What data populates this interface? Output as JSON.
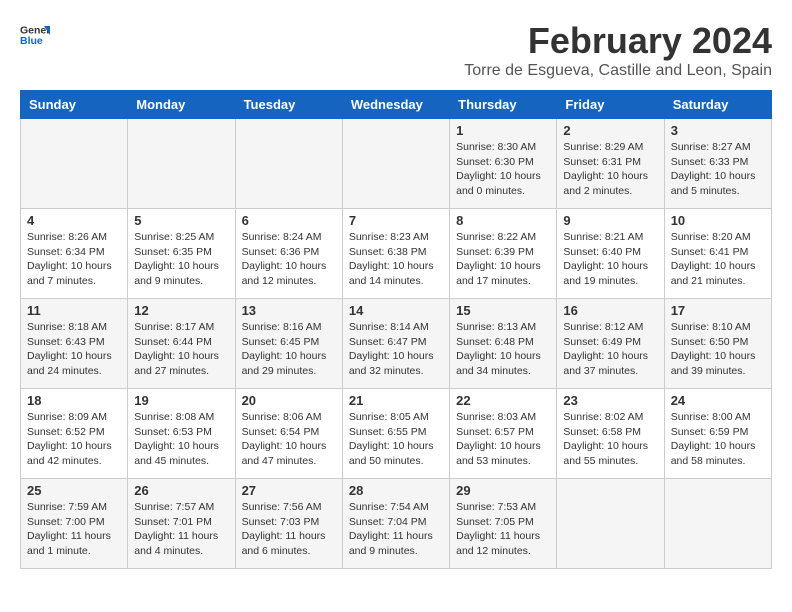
{
  "header": {
    "logo_general": "General",
    "logo_blue": "Blue",
    "month_year": "February 2024",
    "location": "Torre de Esgueva, Castille and Leon, Spain"
  },
  "days_of_week": [
    "Sunday",
    "Monday",
    "Tuesday",
    "Wednesday",
    "Thursday",
    "Friday",
    "Saturday"
  ],
  "weeks": [
    [
      {
        "day": "",
        "info": ""
      },
      {
        "day": "",
        "info": ""
      },
      {
        "day": "",
        "info": ""
      },
      {
        "day": "",
        "info": ""
      },
      {
        "day": "1",
        "info": "Sunrise: 8:30 AM\nSunset: 6:30 PM\nDaylight: 10 hours\nand 0 minutes."
      },
      {
        "day": "2",
        "info": "Sunrise: 8:29 AM\nSunset: 6:31 PM\nDaylight: 10 hours\nand 2 minutes."
      },
      {
        "day": "3",
        "info": "Sunrise: 8:27 AM\nSunset: 6:33 PM\nDaylight: 10 hours\nand 5 minutes."
      }
    ],
    [
      {
        "day": "4",
        "info": "Sunrise: 8:26 AM\nSunset: 6:34 PM\nDaylight: 10 hours\nand 7 minutes."
      },
      {
        "day": "5",
        "info": "Sunrise: 8:25 AM\nSunset: 6:35 PM\nDaylight: 10 hours\nand 9 minutes."
      },
      {
        "day": "6",
        "info": "Sunrise: 8:24 AM\nSunset: 6:36 PM\nDaylight: 10 hours\nand 12 minutes."
      },
      {
        "day": "7",
        "info": "Sunrise: 8:23 AM\nSunset: 6:38 PM\nDaylight: 10 hours\nand 14 minutes."
      },
      {
        "day": "8",
        "info": "Sunrise: 8:22 AM\nSunset: 6:39 PM\nDaylight: 10 hours\nand 17 minutes."
      },
      {
        "day": "9",
        "info": "Sunrise: 8:21 AM\nSunset: 6:40 PM\nDaylight: 10 hours\nand 19 minutes."
      },
      {
        "day": "10",
        "info": "Sunrise: 8:20 AM\nSunset: 6:41 PM\nDaylight: 10 hours\nand 21 minutes."
      }
    ],
    [
      {
        "day": "11",
        "info": "Sunrise: 8:18 AM\nSunset: 6:43 PM\nDaylight: 10 hours\nand 24 minutes."
      },
      {
        "day": "12",
        "info": "Sunrise: 8:17 AM\nSunset: 6:44 PM\nDaylight: 10 hours\nand 27 minutes."
      },
      {
        "day": "13",
        "info": "Sunrise: 8:16 AM\nSunset: 6:45 PM\nDaylight: 10 hours\nand 29 minutes."
      },
      {
        "day": "14",
        "info": "Sunrise: 8:14 AM\nSunset: 6:47 PM\nDaylight: 10 hours\nand 32 minutes."
      },
      {
        "day": "15",
        "info": "Sunrise: 8:13 AM\nSunset: 6:48 PM\nDaylight: 10 hours\nand 34 minutes."
      },
      {
        "day": "16",
        "info": "Sunrise: 8:12 AM\nSunset: 6:49 PM\nDaylight: 10 hours\nand 37 minutes."
      },
      {
        "day": "17",
        "info": "Sunrise: 8:10 AM\nSunset: 6:50 PM\nDaylight: 10 hours\nand 39 minutes."
      }
    ],
    [
      {
        "day": "18",
        "info": "Sunrise: 8:09 AM\nSunset: 6:52 PM\nDaylight: 10 hours\nand 42 minutes."
      },
      {
        "day": "19",
        "info": "Sunrise: 8:08 AM\nSunset: 6:53 PM\nDaylight: 10 hours\nand 45 minutes."
      },
      {
        "day": "20",
        "info": "Sunrise: 8:06 AM\nSunset: 6:54 PM\nDaylight: 10 hours\nand 47 minutes."
      },
      {
        "day": "21",
        "info": "Sunrise: 8:05 AM\nSunset: 6:55 PM\nDaylight: 10 hours\nand 50 minutes."
      },
      {
        "day": "22",
        "info": "Sunrise: 8:03 AM\nSunset: 6:57 PM\nDaylight: 10 hours\nand 53 minutes."
      },
      {
        "day": "23",
        "info": "Sunrise: 8:02 AM\nSunset: 6:58 PM\nDaylight: 10 hours\nand 55 minutes."
      },
      {
        "day": "24",
        "info": "Sunrise: 8:00 AM\nSunset: 6:59 PM\nDaylight: 10 hours\nand 58 minutes."
      }
    ],
    [
      {
        "day": "25",
        "info": "Sunrise: 7:59 AM\nSunset: 7:00 PM\nDaylight: 11 hours\nand 1 minute."
      },
      {
        "day": "26",
        "info": "Sunrise: 7:57 AM\nSunset: 7:01 PM\nDaylight: 11 hours\nand 4 minutes."
      },
      {
        "day": "27",
        "info": "Sunrise: 7:56 AM\nSunset: 7:03 PM\nDaylight: 11 hours\nand 6 minutes."
      },
      {
        "day": "28",
        "info": "Sunrise: 7:54 AM\nSunset: 7:04 PM\nDaylight: 11 hours\nand 9 minutes."
      },
      {
        "day": "29",
        "info": "Sunrise: 7:53 AM\nSunset: 7:05 PM\nDaylight: 11 hours\nand 12 minutes."
      },
      {
        "day": "",
        "info": ""
      },
      {
        "day": "",
        "info": ""
      }
    ]
  ]
}
